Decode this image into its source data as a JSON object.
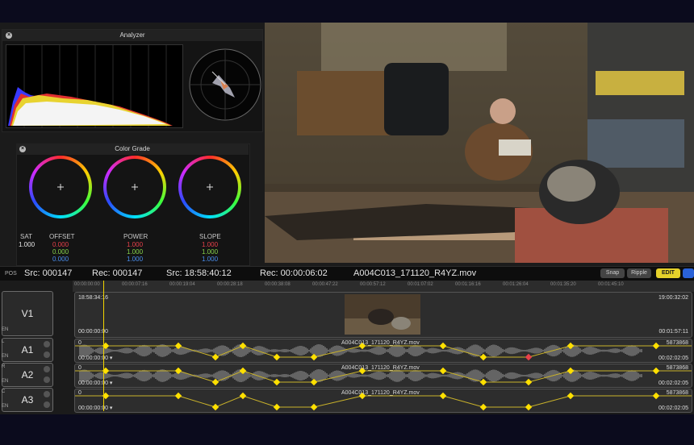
{
  "analyzer": {
    "title": "Analyzer"
  },
  "color_grade": {
    "title": "Color Grade",
    "sat_label": "SAT",
    "sat_value": "1.000",
    "offset": {
      "label": "OFFSET",
      "r": "0.000",
      "g": "0.000",
      "b": "0.000"
    },
    "power": {
      "label": "POWER",
      "r": "1.000",
      "g": "1.000",
      "b": "1.000"
    },
    "slope": {
      "label": "SLOPE",
      "r": "1.000",
      "g": "1.000",
      "b": "1.000"
    }
  },
  "timecode_bar": {
    "pos": "POS",
    "src1": "Src: 000147",
    "rec1": "Rec: 000147",
    "src2": "Src: 18:58:40:12",
    "rec2": "Rec: 00:00:06:02",
    "clip": "A004C013_171120_R4YZ.mov",
    "snap": "Snap",
    "ripple": "Ripple",
    "edit": "EDIT"
  },
  "ruler": [
    "00:00:00:00",
    "00:00:07:16",
    "00:00:19:04",
    "00:00:28:18",
    "00:00:38:08",
    "00:00:47:22",
    "00:00:57:12",
    "00:01:07:02",
    "00:01:16:16",
    "00:01:26:04",
    "00:01:35:20",
    "00:01:45:10"
  ],
  "tracks": {
    "v1": {
      "name": "V1",
      "en": "EN",
      "tc_start": "18:58:34:16",
      "tc_end": "19:00:32:02",
      "rec_start": "00:00:00:00",
      "rec_end": "00:01:57:11"
    },
    "a1": {
      "name": "A1",
      "ch": "L",
      "en": "EN",
      "zero": "0",
      "samples": "5873868",
      "clip": "A004C013_171120_R4YZ.mov",
      "rec_start": "00:00:00:00 ▾",
      "rec_end": "00:02:02:05"
    },
    "a2": {
      "name": "A2",
      "ch": "R",
      "en": "EN",
      "zero": "0",
      "samples": "5873868",
      "clip": "A004C013_171120_R4YZ.mov",
      "rec_start": "00:00:00:00 ▾",
      "rec_end": "00:02:02:05"
    },
    "a3": {
      "name": "A3",
      "ch": "C",
      "en": "EN",
      "zero": "0",
      "samples": "5873868",
      "clip": "A004C013_171120_R4YZ.mov",
      "rec_start": "00:00:00:00 ▾",
      "rec_end": "00:02:02:05"
    }
  },
  "colors": {
    "accent": "#f2d500",
    "keyframe": "#ffe000",
    "keyframe_sel": "#e8414a"
  }
}
